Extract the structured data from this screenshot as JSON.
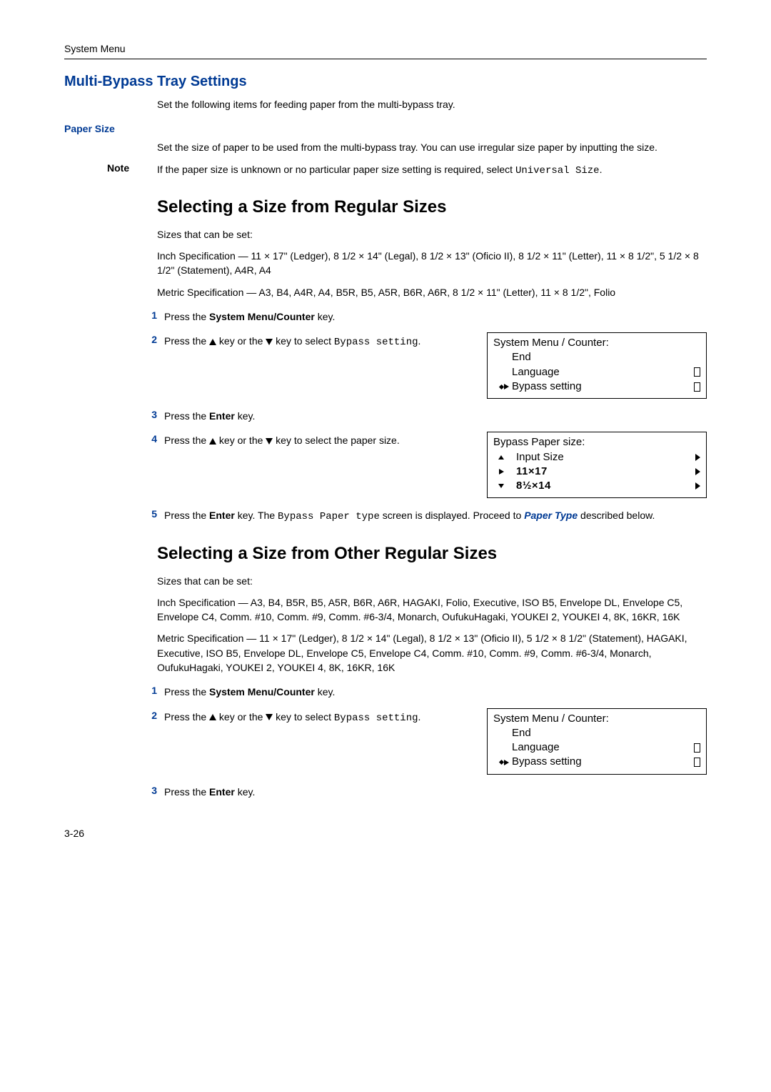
{
  "runningHead": "System Menu",
  "section": {
    "title": "Multi-Bypass Tray Settings",
    "intro": "Set the following items for feeding paper from the multi-bypass tray."
  },
  "paperSize": {
    "heading": "Paper Size",
    "para1": "Set the size of paper to be used from the multi-bypass tray. You can use irregular size paper by inputting the size.",
    "noteLabel": "Note",
    "notePrefix": "If the paper size is unknown or no particular paper size setting is required, select ",
    "noteMono1": "Universal Size",
    "noteSuffix": "."
  },
  "regular": {
    "heading": "Selecting a Size from Regular Sizes",
    "sizesLead": "Sizes that can be set:",
    "inchLabel": "Inch Specification — ",
    "inchBody": "11 × 17\" (Ledger), 8 1/2 × 14\" (Legal), 8 1/2 × 13\" (Oficio II), 8 1/2 × 11\" (Letter), 11 × 8 1/2\", 5 1/2 × 8 1/2\" (Statement), A4R, A4",
    "metricLabel": "Metric Specification — ",
    "metricBody": "A3, B4, A4R, A4, B5R, B5, A5R, B6R, A6R, 8 1/2 × 11\" (Letter), 11 × 8 1/2\", Folio",
    "steps": {
      "s1a": "Press the ",
      "s1b": "System Menu/Counter",
      "s1c": " key.",
      "s2a": "Press the ",
      "s2b": " key or the ",
      "s2c": " key to select ",
      "s2mono": "Bypass setting",
      "s2d": ".",
      "s3a": "Press the ",
      "s3b": "Enter",
      "s3c": " key.",
      "s4a": "Press the ",
      "s4b": " key or the ",
      "s4c": " key to select the paper size.",
      "s5a": "Press the ",
      "s5b": "Enter",
      "s5c": " key. The ",
      "s5mono": "Bypass Paper type",
      "s5d": " screen is displayed. Proceed to ",
      "s5link": "Paper Type",
      "s5e": " described below."
    }
  },
  "other": {
    "heading": "Selecting a Size from Other Regular Sizes",
    "sizesLead": "Sizes that can be set:",
    "inchLabel": "Inch Specification — ",
    "inchBody": "A3, B4, B5R, B5, A5R, B6R, A6R, HAGAKI, Folio, Executive, ISO B5, Envelope DL, Envelope C5, Envelope C4, Comm. #10, Comm. #9, Comm. #6-3/4, Monarch, OufukuHagaki, YOUKEI 2, YOUKEI 4, 8K, 16KR, 16K",
    "metricLabel": "Metric Specification — ",
    "metricBody": "11 × 17\" (Ledger), 8 1/2 × 14\" (Legal), 8 1/2 × 13\" (Oficio II), 5 1/2 × 8 1/2\" (Statement), HAGAKI, Executive, ISO B5, Envelope DL, Envelope C5, Envelope C4, Comm. #10, Comm. #9, Comm. #6-3/4, Monarch, OufukuHagaki, YOUKEI 2, YOUKEI 4, 8K, 16KR, 16K",
    "steps": {
      "s1a": "Press the ",
      "s1b": "System Menu/Counter",
      "s1c": " key.",
      "s2a": "Press the ",
      "s2b": " key or the ",
      "s2c": " key to select ",
      "s2mono": "Bypass setting",
      "s2d": ".",
      "s3a": "Press the ",
      "s3b": "Enter",
      "s3c": " key."
    }
  },
  "lcd1": {
    "title": "System Menu / Counter:",
    "r1": "End",
    "r2": "Language",
    "r3": "Bypass setting"
  },
  "lcd2": {
    "title": "Bypass Paper size:",
    "r1": "Input Size",
    "r2": "11×17",
    "r3": "8½×14"
  },
  "lcd3": {
    "title": "System Menu / Counter:",
    "r1": "End",
    "r2": "Language",
    "r3": "Bypass setting"
  },
  "pageNum": "3-26"
}
